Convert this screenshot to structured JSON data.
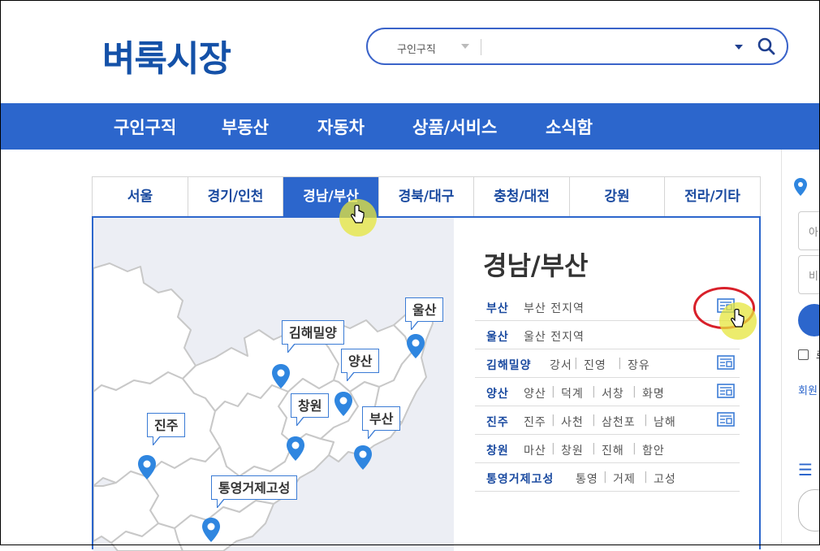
{
  "header": {
    "logo": "벼룩시장",
    "search": {
      "category": "구인구직",
      "query": ""
    }
  },
  "nav": {
    "items": [
      "구인구직",
      "부동산",
      "자동차",
      "상품/서비스",
      "소식함"
    ]
  },
  "tabs": [
    "서울",
    "경기/인천",
    "경남/부산",
    "경북/대구",
    "충청/대전",
    "강원",
    "전라/기타"
  ],
  "active_tab": "경남/부산",
  "region": {
    "title": "경남/부산",
    "rows": [
      {
        "name": "부산",
        "subs": [
          "부산 전지역"
        ],
        "has_icon": true
      },
      {
        "name": "울산",
        "subs": [
          "울산 전지역"
        ],
        "has_icon": false
      },
      {
        "name": "김해밀양",
        "subs": [
          "강서",
          "진영",
          "장유"
        ],
        "has_icon": true
      },
      {
        "name": "양산",
        "subs": [
          "양산",
          "덕계",
          "서창",
          "화명"
        ],
        "has_icon": true
      },
      {
        "name": "진주",
        "subs": [
          "진주",
          "사천",
          "삼천포",
          "남해"
        ],
        "has_icon": true
      },
      {
        "name": "창원",
        "subs": [
          "마산",
          "창원",
          "진해",
          "함안"
        ],
        "has_icon": false
      },
      {
        "name": "통영거제고성",
        "subs": [
          "통영",
          "거제",
          "고성"
        ],
        "has_icon": false
      }
    ]
  },
  "map": {
    "labels": [
      "울산",
      "김해밀양",
      "양산",
      "창원",
      "부산",
      "진주",
      "통영거제고성"
    ]
  },
  "side": {
    "field1_placeholder": "아",
    "field2_placeholder": "비",
    "checkbox_label": "로",
    "join_link": "회원"
  },
  "colors": {
    "brand": "#1451a8",
    "nav": "#2c66cc",
    "pin": "#2f86e0"
  }
}
